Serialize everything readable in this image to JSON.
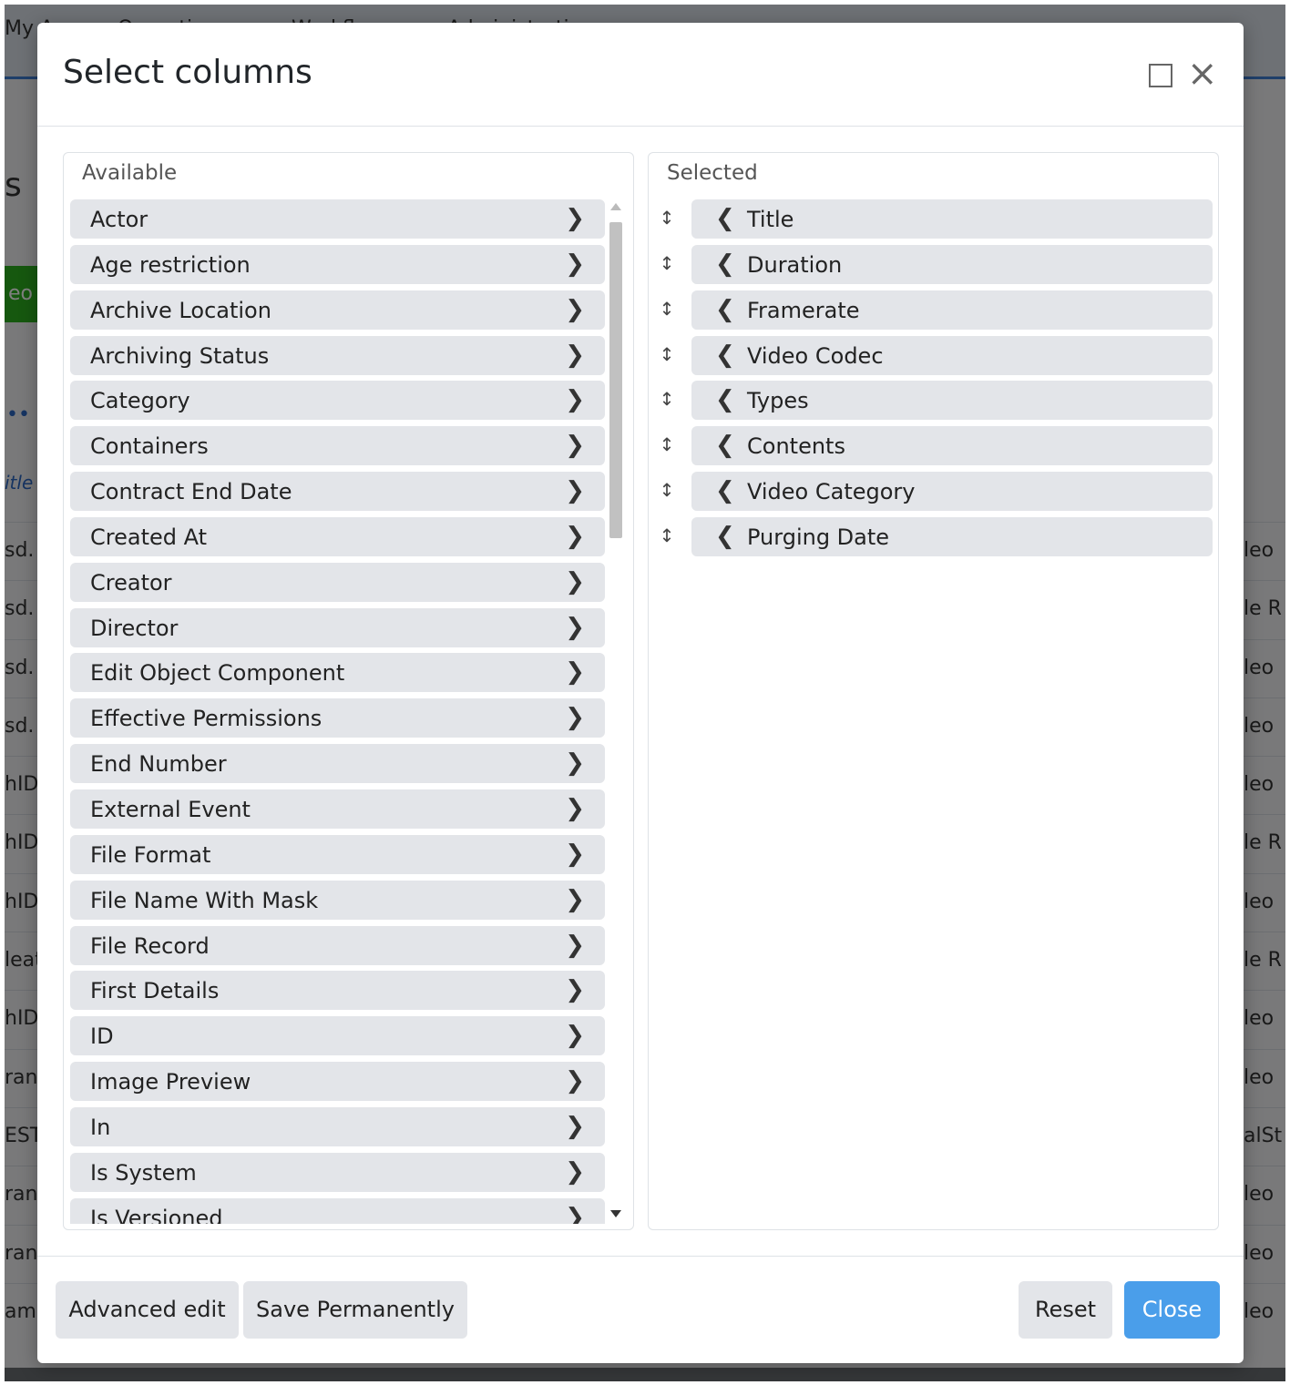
{
  "background": {
    "nav": [
      "My A",
      "Operations",
      "Workflow",
      "Administration"
    ],
    "heading": "s",
    "green_button": "eo A",
    "dots": "••",
    "title_column": "itle",
    "rows_left": [
      "sd.",
      "sd.",
      "sd.",
      "sd.",
      "hID",
      "hID",
      "hID",
      "leat",
      "hID",
      "rans",
      "EST",
      "rans",
      "rans",
      "am"
    ],
    "rows_right": [
      "leo",
      "le R",
      "leo",
      "leo",
      "leo",
      "le R",
      "leo",
      "le R",
      "leo",
      "leo",
      "alSt",
      "leo",
      "leo",
      "leo"
    ]
  },
  "modal": {
    "title": "Select columns",
    "available_label": "Available",
    "selected_label": "Selected",
    "available": [
      "Actor",
      "Age restriction",
      "Archive Location",
      "Archiving Status",
      "Category",
      "Containers",
      "Contract End Date",
      "Created At",
      "Creator",
      "Director",
      "Edit Object Component",
      "Effective Permissions",
      "End Number",
      "External Event",
      "File Format",
      "File Name With Mask",
      "File Record",
      "First Details",
      "ID",
      "Image Preview",
      "In",
      "Is System",
      "Is Versioned"
    ],
    "selected": [
      "Title",
      "Duration",
      "Framerate",
      "Video Codec",
      "Types",
      "Contents",
      "Video Category",
      "Purging Date"
    ],
    "footer": {
      "advanced_edit": "Advanced edit",
      "save_permanently": "Save Permanently",
      "reset": "Reset",
      "close": "Close"
    }
  },
  "icons": {
    "maximize": "maximize-icon",
    "close": "close-icon",
    "move_right": "chevron-right-icon",
    "move_left": "chevron-left-icon",
    "drag": "drag-handle-icon"
  },
  "colors": {
    "primary": "#4a9eea",
    "item_bg": "#e3e5e9",
    "accent_green": "#2db11f"
  }
}
